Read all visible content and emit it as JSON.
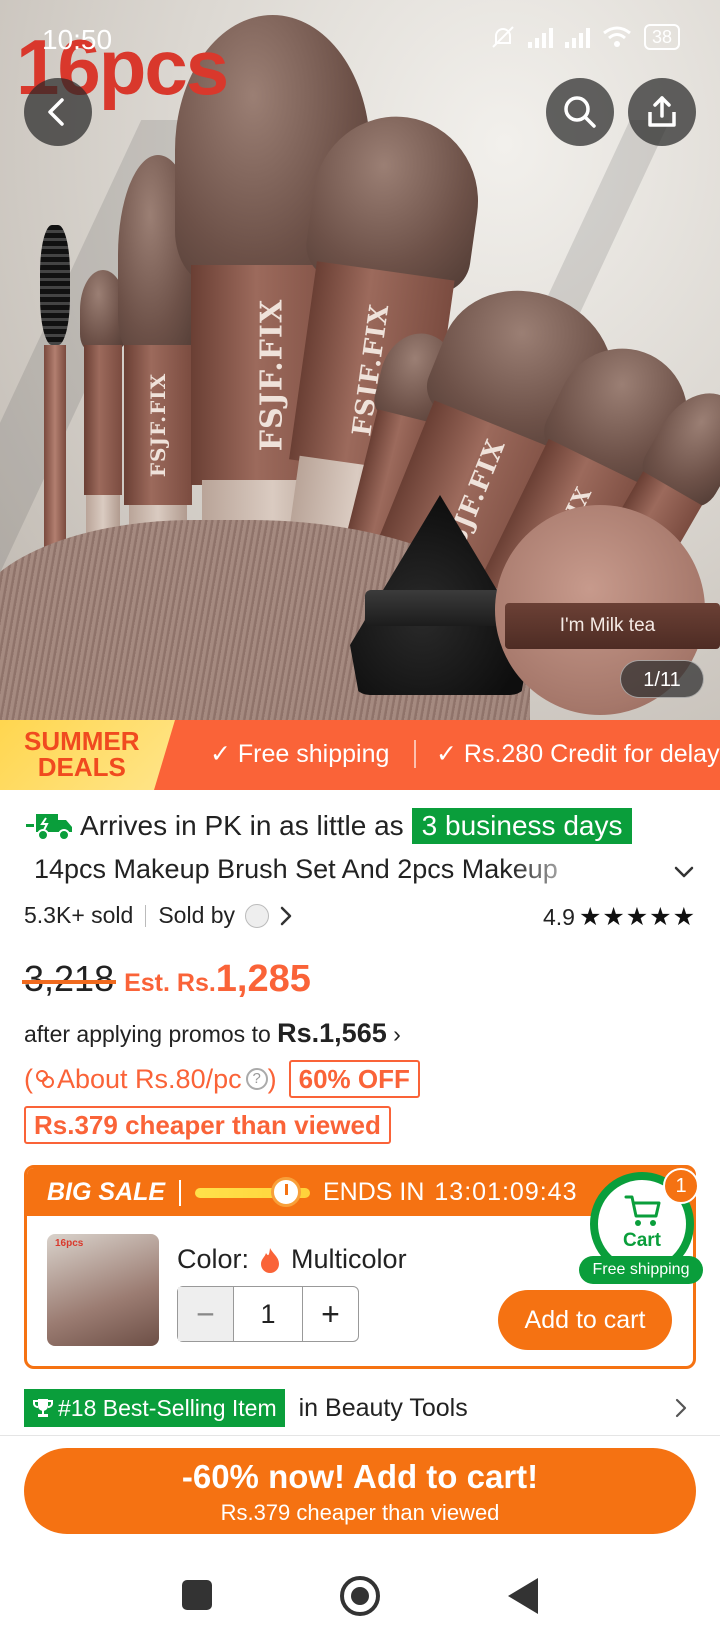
{
  "status_bar": {
    "time": "10:50",
    "battery": "38"
  },
  "hero": {
    "caption": "16pcs",
    "brand_text": "FSJF.FIX",
    "puff_label": "I'm Milk tea",
    "image_counter": "1/11"
  },
  "promo_strip": {
    "badge_line1": "SUMMER",
    "badge_line2": "DEALS",
    "items": [
      "Free shipping",
      "Rs.280 Credit for delay"
    ]
  },
  "product": {
    "arrival_prefix": "Arrives in PK in as little as",
    "arrival_days": "3 business days",
    "title": "14pcs Makeup Brush Set And 2pcs Makeup",
    "sold": "5.3K+ sold",
    "sold_by": "Sold by",
    "rating": "4.9",
    "stars": "★★★★★",
    "stars_value": 5
  },
  "pricing": {
    "old_price": "3,218",
    "est_label": "Est. Rs.",
    "new_price": "1,285",
    "after_promos_text": "after applying promos to",
    "after_promos_price": "Rs.1,565",
    "per_pc": "About Rs.80/pc",
    "discount": "60% OFF",
    "cheaper": "Rs.379 cheaper than viewed"
  },
  "big_sale": {
    "title": "BIG SALE",
    "ends_in_label": "ENDS IN",
    "countdown": "13:01:09:43",
    "color_label": "Color:",
    "color_value": "Multicolor",
    "quantity": "1",
    "add_to_cart": "Add to cart",
    "thumb_caption": "16pcs"
  },
  "floating_cart": {
    "label": "Cart",
    "count": "1",
    "shipping": "Free shipping"
  },
  "best_selling": {
    "badge": "#18 Best-Selling Item",
    "category": "in Beauty Tools"
  },
  "cta": {
    "main": "-60% now! Add to cart!",
    "sub": "Rs.379 cheaper than viewed"
  },
  "colors": {
    "accent_orange": "#fa6338",
    "button_orange": "#f57212",
    "green": "#0a9e3b"
  }
}
